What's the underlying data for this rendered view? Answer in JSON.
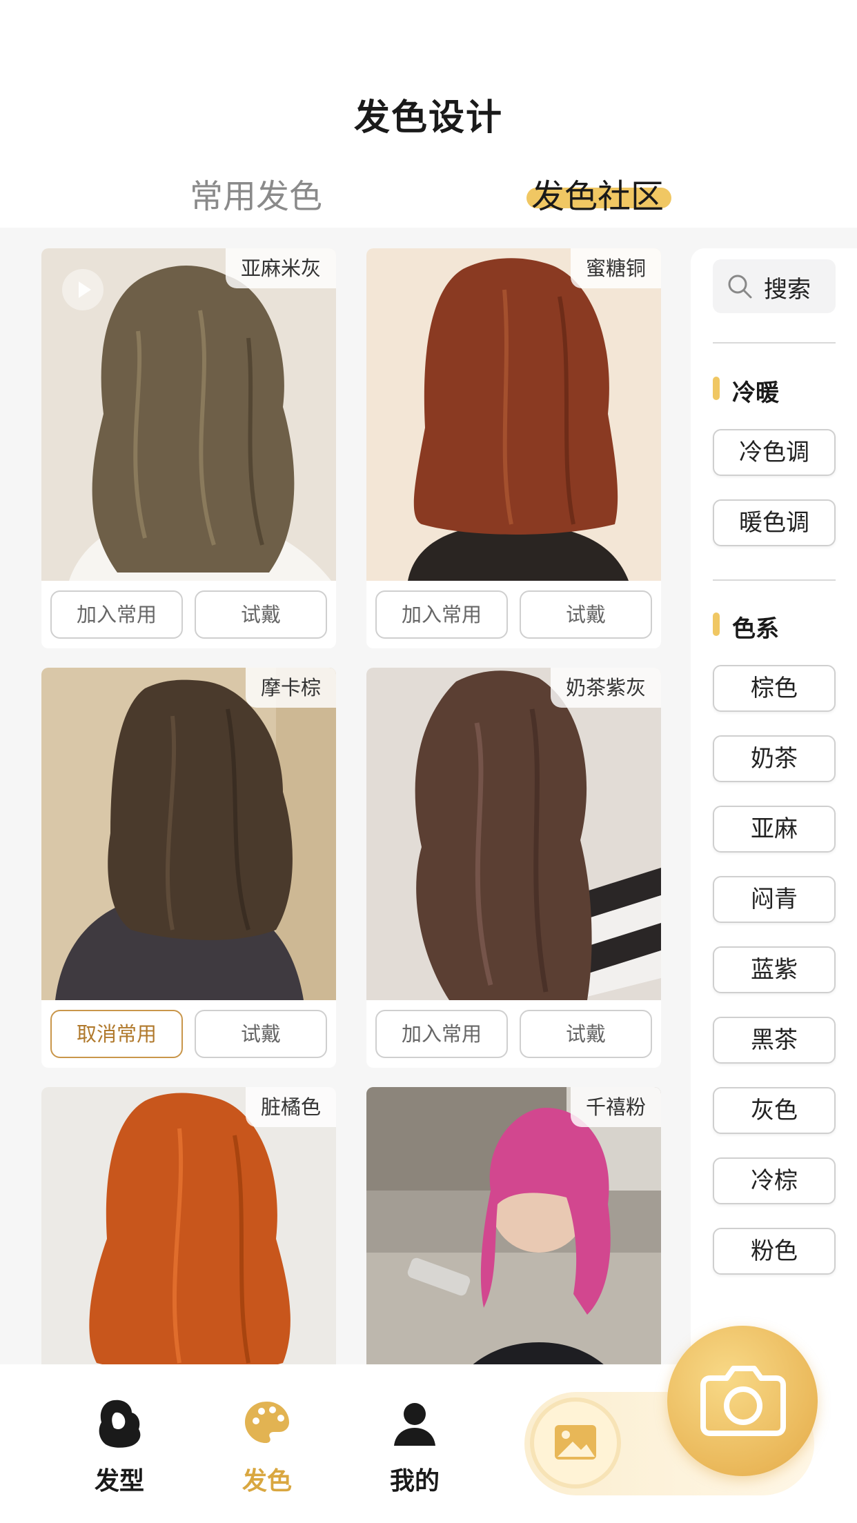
{
  "header": {
    "title": "发色设计",
    "tabs": [
      {
        "label": "常用发色",
        "active": false
      },
      {
        "label": "发色社区",
        "active": true
      }
    ]
  },
  "colors": {
    "accent": "#f0c763",
    "accent_text": "#d9a740",
    "active_border": "#c9964a"
  },
  "cards": [
    {
      "name": "亚麻米灰",
      "has_video": true,
      "add_label": "加入常用",
      "try_label": "试戴",
      "hair_color": "#6e5f48"
    },
    {
      "name": "蜜糖铜",
      "has_video": false,
      "add_label": "加入常用",
      "try_label": "试戴",
      "hair_color": "#8a3a22"
    },
    {
      "name": "摩卡棕",
      "has_video": false,
      "add_label": "取消常用",
      "add_active": true,
      "try_label": "试戴",
      "hair_color": "#4a3a2c"
    },
    {
      "name": "奶茶紫灰",
      "has_video": false,
      "add_label": "加入常用",
      "try_label": "试戴",
      "hair_color": "#5b3f33"
    },
    {
      "name": "脏橘色",
      "has_video": false,
      "hair_color": "#c8561c"
    },
    {
      "name": "千禧粉",
      "has_video": false,
      "hair_color": "#d2478f"
    }
  ],
  "filters": {
    "search_label": "搜索",
    "sections": [
      {
        "title": "冷暖",
        "chips": [
          "冷色调",
          "暖色调"
        ]
      },
      {
        "title": "色系",
        "chips": [
          "棕色",
          "奶茶",
          "亚麻",
          "闷青",
          "蓝紫",
          "黑茶",
          "灰色",
          "冷棕",
          "粉色"
        ]
      }
    ]
  },
  "bottom_nav": [
    {
      "label": "发型",
      "icon": "hairstyle-icon",
      "active": false
    },
    {
      "label": "发色",
      "icon": "palette-icon",
      "active": true
    },
    {
      "label": "我的",
      "icon": "user-icon",
      "active": false
    }
  ],
  "actions": {
    "gallery_icon": "image-icon",
    "camera_icon": "camera-icon"
  }
}
